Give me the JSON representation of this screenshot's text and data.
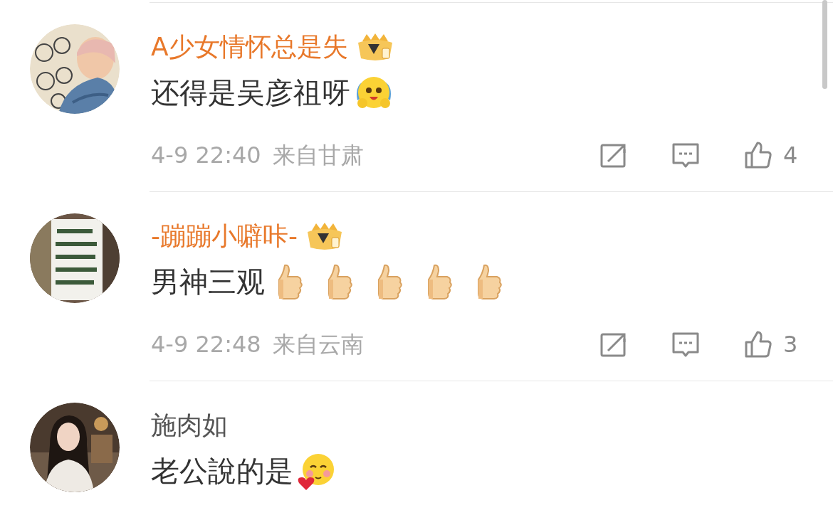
{
  "comments": [
    {
      "name": "A少女情怀总是失",
      "vip": true,
      "text": "还得是吴彦祖呀",
      "time": "4-9 22:40",
      "location": "来自甘肃",
      "likes": "4"
    },
    {
      "name": "-蹦蹦小噼咔-",
      "vip": true,
      "text": "男神三观",
      "time": "4-9 22:48",
      "location": "来自云南",
      "likes": "3"
    },
    {
      "name": "施肉如",
      "vip": false,
      "text": "老公說的是"
    }
  ]
}
